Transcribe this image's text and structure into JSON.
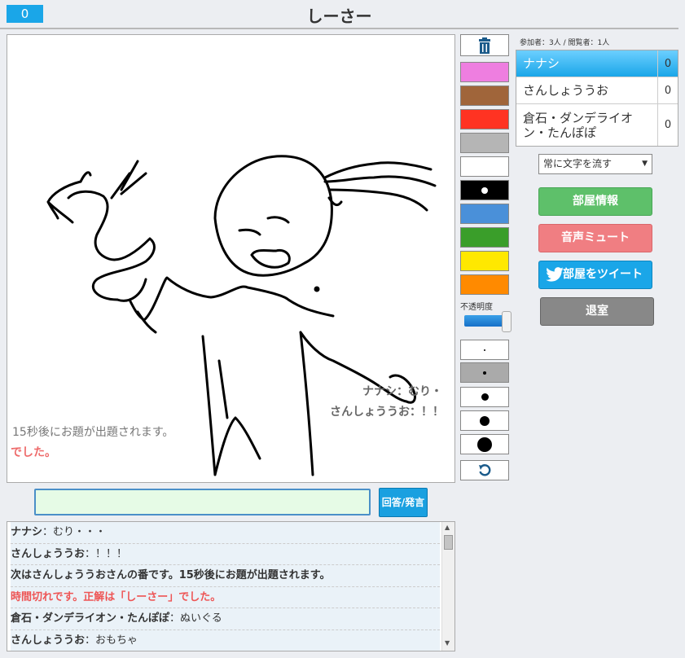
{
  "header": {
    "score": "0",
    "title": "しーさー"
  },
  "canvas_overlay": {
    "msg1": "ナナシ：むり・",
    "msg2": "さんしょううお：！！",
    "msg3": "15秒後にお題が出題されます。",
    "msg4": "でした。"
  },
  "tools": {
    "trash_icon": "trash-icon",
    "colors": [
      "#ee7ee0",
      "#a0653a",
      "#ff3322",
      "#b5b5b5",
      "#ffffff",
      "#000000",
      "#4a90d9",
      "#3a9e2a",
      "#ffe800",
      "#ff8a00"
    ],
    "opacity_label": "不透明度",
    "opacity_level": 1.0,
    "undo_icon": "undo-icon"
  },
  "chat": {
    "input_value": "",
    "answer_button": "回答/発言",
    "log": [
      {
        "name": "ナナシ",
        "text": "：むり・・・",
        "kind": "user"
      },
      {
        "name": "さんしょううお",
        "text": "：！！！",
        "kind": "user"
      },
      {
        "text": "次はさんしょううおさんの番です。15秒後にお題が出題されます。",
        "kind": "system"
      },
      {
        "text": "時間切れです。正解は「しーさー」でした。",
        "kind": "alert"
      },
      {
        "name": "倉石・ダンデライオン・たんぽぽ",
        "text": "：ぬいぐる",
        "kind": "user"
      },
      {
        "name": "さんしょううお",
        "text": "：おもちゃ",
        "kind": "user"
      }
    ]
  },
  "room": {
    "participants_label": "参加者：3人 / 閲覧者：1人",
    "players": [
      {
        "name": "ナナシ",
        "score": "0",
        "active": true
      },
      {
        "name": "さんしょううお",
        "score": "0",
        "active": false
      },
      {
        "name": "倉石・ダンデライオン・たんぽぽ",
        "score": "0",
        "active": false
      }
    ],
    "scroll_option": "常に文字を流す",
    "room_info_button": "部屋情報",
    "mute_button": "音声ミュート",
    "tweet_button": "部屋をツイート",
    "leave_button": "退室"
  }
}
